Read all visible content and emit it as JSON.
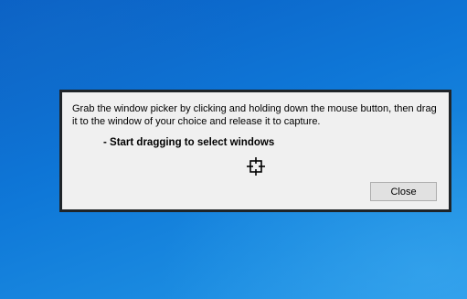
{
  "dialog": {
    "message": "Grab the window picker by clicking and holding down the mouse button, then drag it to the window of your choice and release it to capture.",
    "instruction": "- Start dragging to select windows",
    "picker_icon": "crosshair-target-icon",
    "close_label": "Close"
  }
}
